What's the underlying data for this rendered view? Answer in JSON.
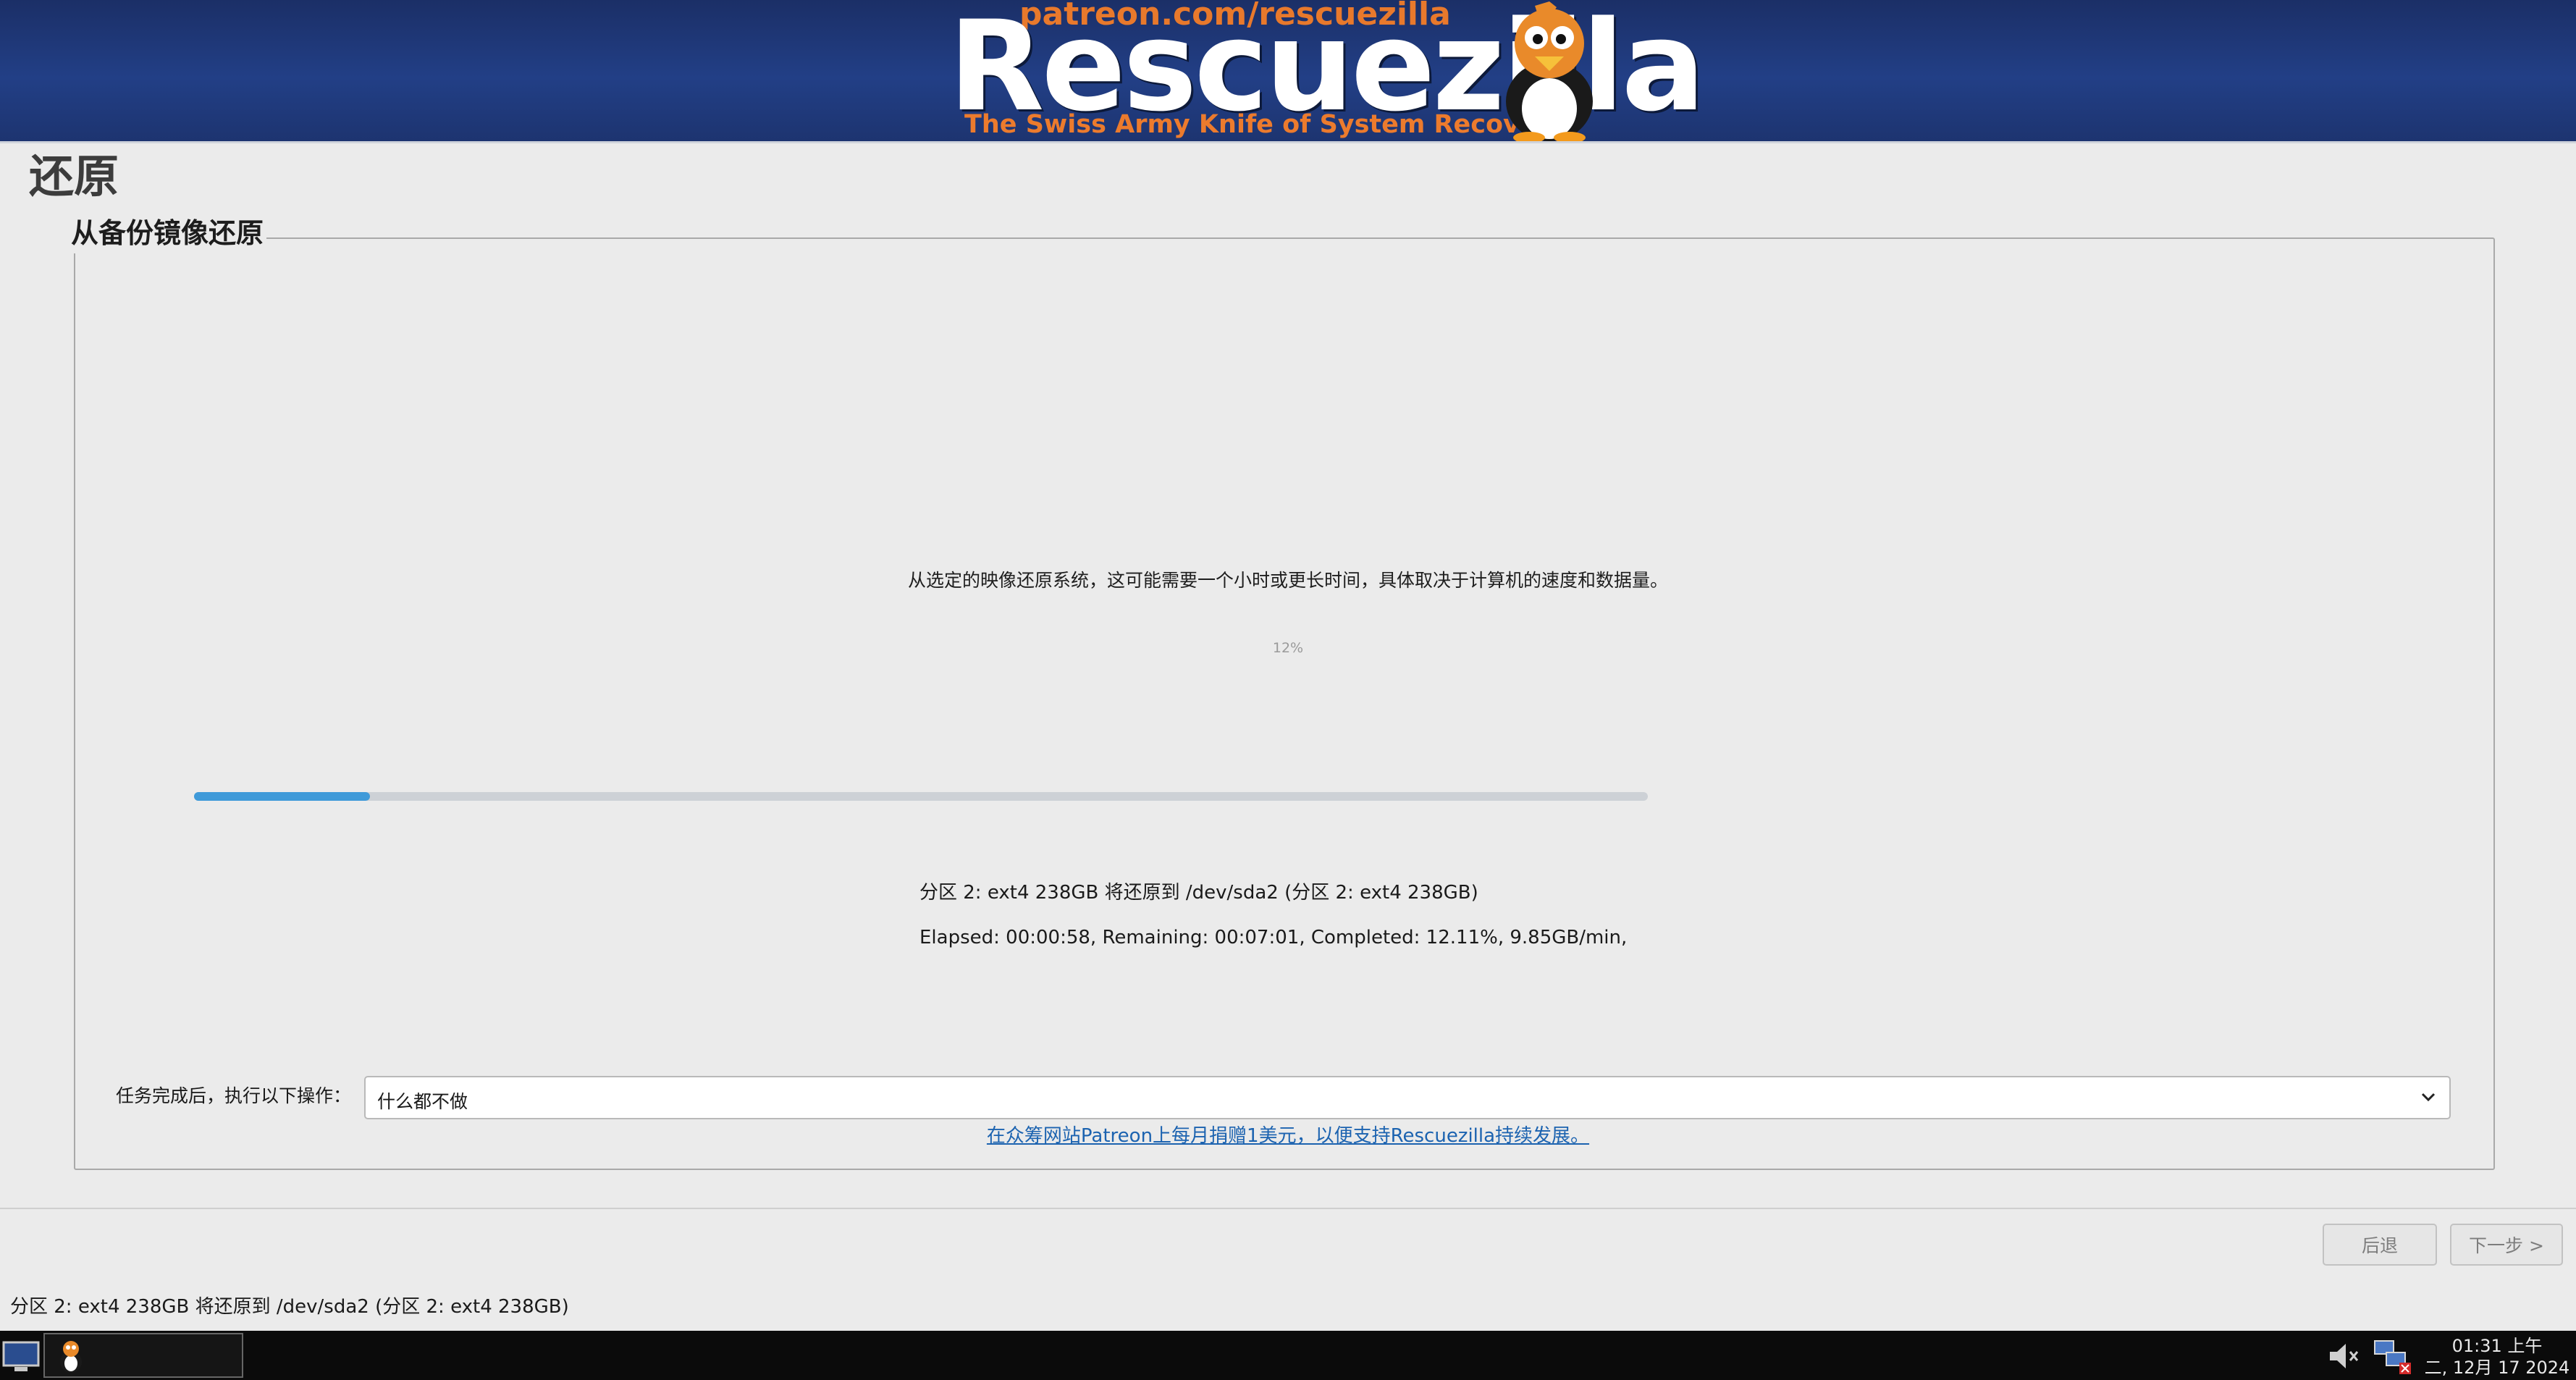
{
  "banner": {
    "patreon_url": "patreon.com/rescuezilla",
    "logo_text": "Rescuezilla",
    "tagline": "The Swiss Army Knife of System Recovery",
    "mascot_icon": "penguin-mascot-icon"
  },
  "page": {
    "title": "还原",
    "section_title": "从备份镜像还原",
    "description": "从选定的映像还原系统，这可能需要一个小时或更长时间，具体取决于计算机的速度和数据量。",
    "progress_label": "12%",
    "progress_fraction": 0.121,
    "progress_color": "#3f9ad9",
    "partition_line": "分区 2: ext4 238GB 将还原到 /dev/sda2 (分区 2: ext4 238GB)",
    "stats_line": "Elapsed: 00:00:58, Remaining: 00:07:01, Completed:  12.11%,   9.85GB/min,",
    "after_label": "任务完成后，执行以下操作：",
    "after_value": "什么都不做",
    "donate_link": "在众筹网站Patreon上每月捐赠1美元，以便支持Rescuezilla持续发展。"
  },
  "buttons": {
    "back": "后退",
    "next": "下一步 >"
  },
  "status_bar": "分区 2: ext4 238GB 将还原到 /dev/sda2 (分区 2: ext4 238GB)",
  "taskbar": {
    "clock_time": "01:31 上午",
    "clock_date": "二, 12月 17 2024",
    "accent_color": "#0b0b0b"
  }
}
